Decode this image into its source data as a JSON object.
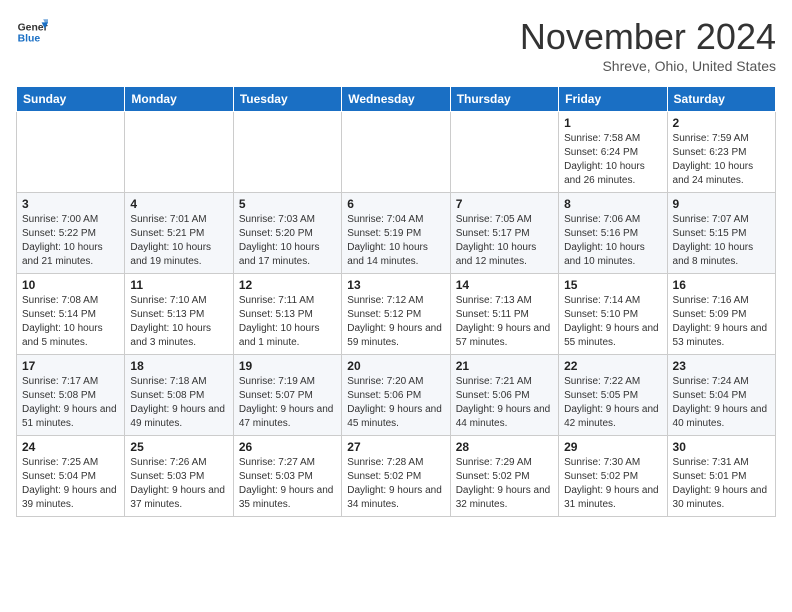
{
  "header": {
    "logo_line1": "General",
    "logo_line2": "Blue",
    "month": "November 2024",
    "location": "Shreve, Ohio, United States"
  },
  "days_of_week": [
    "Sunday",
    "Monday",
    "Tuesday",
    "Wednesday",
    "Thursday",
    "Friday",
    "Saturday"
  ],
  "weeks": [
    [
      {
        "day": "",
        "info": ""
      },
      {
        "day": "",
        "info": ""
      },
      {
        "day": "",
        "info": ""
      },
      {
        "day": "",
        "info": ""
      },
      {
        "day": "",
        "info": ""
      },
      {
        "day": "1",
        "info": "Sunrise: 7:58 AM\nSunset: 6:24 PM\nDaylight: 10 hours and 26 minutes."
      },
      {
        "day": "2",
        "info": "Sunrise: 7:59 AM\nSunset: 6:23 PM\nDaylight: 10 hours and 24 minutes."
      }
    ],
    [
      {
        "day": "3",
        "info": "Sunrise: 7:00 AM\nSunset: 5:22 PM\nDaylight: 10 hours and 21 minutes."
      },
      {
        "day": "4",
        "info": "Sunrise: 7:01 AM\nSunset: 5:21 PM\nDaylight: 10 hours and 19 minutes."
      },
      {
        "day": "5",
        "info": "Sunrise: 7:03 AM\nSunset: 5:20 PM\nDaylight: 10 hours and 17 minutes."
      },
      {
        "day": "6",
        "info": "Sunrise: 7:04 AM\nSunset: 5:19 PM\nDaylight: 10 hours and 14 minutes."
      },
      {
        "day": "7",
        "info": "Sunrise: 7:05 AM\nSunset: 5:17 PM\nDaylight: 10 hours and 12 minutes."
      },
      {
        "day": "8",
        "info": "Sunrise: 7:06 AM\nSunset: 5:16 PM\nDaylight: 10 hours and 10 minutes."
      },
      {
        "day": "9",
        "info": "Sunrise: 7:07 AM\nSunset: 5:15 PM\nDaylight: 10 hours and 8 minutes."
      }
    ],
    [
      {
        "day": "10",
        "info": "Sunrise: 7:08 AM\nSunset: 5:14 PM\nDaylight: 10 hours and 5 minutes."
      },
      {
        "day": "11",
        "info": "Sunrise: 7:10 AM\nSunset: 5:13 PM\nDaylight: 10 hours and 3 minutes."
      },
      {
        "day": "12",
        "info": "Sunrise: 7:11 AM\nSunset: 5:13 PM\nDaylight: 10 hours and 1 minute."
      },
      {
        "day": "13",
        "info": "Sunrise: 7:12 AM\nSunset: 5:12 PM\nDaylight: 9 hours and 59 minutes."
      },
      {
        "day": "14",
        "info": "Sunrise: 7:13 AM\nSunset: 5:11 PM\nDaylight: 9 hours and 57 minutes."
      },
      {
        "day": "15",
        "info": "Sunrise: 7:14 AM\nSunset: 5:10 PM\nDaylight: 9 hours and 55 minutes."
      },
      {
        "day": "16",
        "info": "Sunrise: 7:16 AM\nSunset: 5:09 PM\nDaylight: 9 hours and 53 minutes."
      }
    ],
    [
      {
        "day": "17",
        "info": "Sunrise: 7:17 AM\nSunset: 5:08 PM\nDaylight: 9 hours and 51 minutes."
      },
      {
        "day": "18",
        "info": "Sunrise: 7:18 AM\nSunset: 5:08 PM\nDaylight: 9 hours and 49 minutes."
      },
      {
        "day": "19",
        "info": "Sunrise: 7:19 AM\nSunset: 5:07 PM\nDaylight: 9 hours and 47 minutes."
      },
      {
        "day": "20",
        "info": "Sunrise: 7:20 AM\nSunset: 5:06 PM\nDaylight: 9 hours and 45 minutes."
      },
      {
        "day": "21",
        "info": "Sunrise: 7:21 AM\nSunset: 5:06 PM\nDaylight: 9 hours and 44 minutes."
      },
      {
        "day": "22",
        "info": "Sunrise: 7:22 AM\nSunset: 5:05 PM\nDaylight: 9 hours and 42 minutes."
      },
      {
        "day": "23",
        "info": "Sunrise: 7:24 AM\nSunset: 5:04 PM\nDaylight: 9 hours and 40 minutes."
      }
    ],
    [
      {
        "day": "24",
        "info": "Sunrise: 7:25 AM\nSunset: 5:04 PM\nDaylight: 9 hours and 39 minutes."
      },
      {
        "day": "25",
        "info": "Sunrise: 7:26 AM\nSunset: 5:03 PM\nDaylight: 9 hours and 37 minutes."
      },
      {
        "day": "26",
        "info": "Sunrise: 7:27 AM\nSunset: 5:03 PM\nDaylight: 9 hours and 35 minutes."
      },
      {
        "day": "27",
        "info": "Sunrise: 7:28 AM\nSunset: 5:02 PM\nDaylight: 9 hours and 34 minutes."
      },
      {
        "day": "28",
        "info": "Sunrise: 7:29 AM\nSunset: 5:02 PM\nDaylight: 9 hours and 32 minutes."
      },
      {
        "day": "29",
        "info": "Sunrise: 7:30 AM\nSunset: 5:02 PM\nDaylight: 9 hours and 31 minutes."
      },
      {
        "day": "30",
        "info": "Sunrise: 7:31 AM\nSunset: 5:01 PM\nDaylight: 9 hours and 30 minutes."
      }
    ]
  ]
}
